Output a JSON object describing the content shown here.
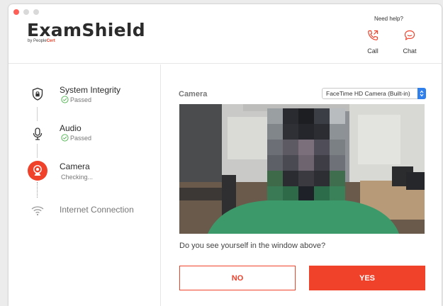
{
  "header": {
    "logo": "ExamShield",
    "by": "by People",
    "brand": "Cert",
    "help_text": "Need help?",
    "call_label": "Call",
    "chat_label": "Chat"
  },
  "steps": [
    {
      "title": "System Integrity",
      "status": "Passed",
      "icon": "shield-lock-icon"
    },
    {
      "title": "Audio",
      "status": "Passed",
      "icon": "microphone-icon"
    },
    {
      "title": "Camera",
      "status": "Checking...",
      "icon": "webcam-icon"
    },
    {
      "title": "Internet Connection",
      "status": "",
      "icon": "wifi-icon"
    }
  ],
  "camera": {
    "label": "Camera",
    "selected_device": "FaceTime HD Camera (Built-in)"
  },
  "question": "Do you see yourself in the window above?",
  "buttons": {
    "no": "NO",
    "yes": "YES"
  },
  "colors": {
    "accent": "#f0412b",
    "passed": "#5cb85c",
    "select_arrow": "#2f80ed"
  }
}
